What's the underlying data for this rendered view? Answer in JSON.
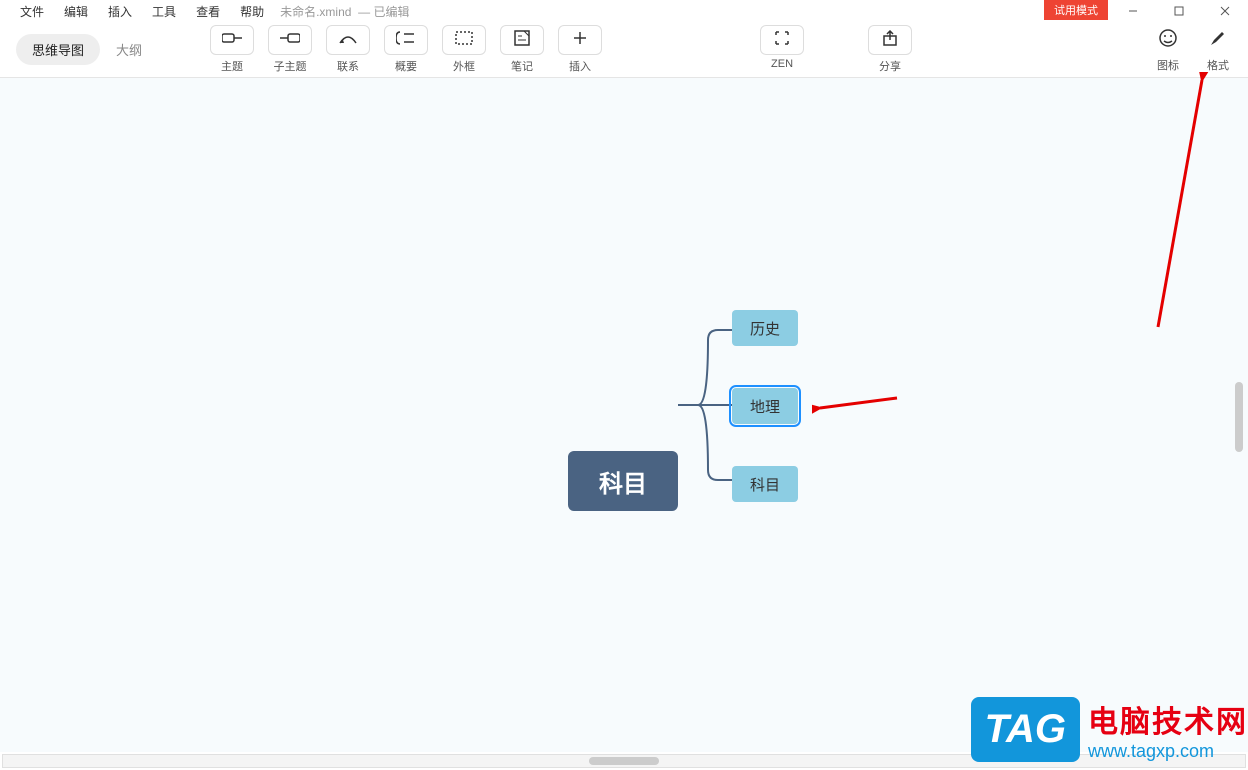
{
  "menubar": {
    "file": "文件",
    "edit": "编辑",
    "insert": "插入",
    "tools": "工具",
    "view": "查看",
    "help": "帮助",
    "filename": "未命名.xmind",
    "edited": "— 已编辑",
    "trial": "试用模式"
  },
  "viewtabs": {
    "mindmap": "思维导图",
    "outline": "大纲"
  },
  "toolbar": {
    "topic": "主题",
    "subtopic": "子主题",
    "relationship": "联系",
    "summary": "概要",
    "boundary": "外框",
    "notes": "笔记",
    "insert": "插入",
    "zen": "ZEN",
    "share": "分享",
    "icons": "图标",
    "format": "格式"
  },
  "mindmap": {
    "central": "科目",
    "child1": "历史",
    "child2": "地理",
    "child3": "科目"
  },
  "watermark": {
    "tag": "TAG",
    "cn": "电脑技术网",
    "url": "www.tagxp.com"
  }
}
